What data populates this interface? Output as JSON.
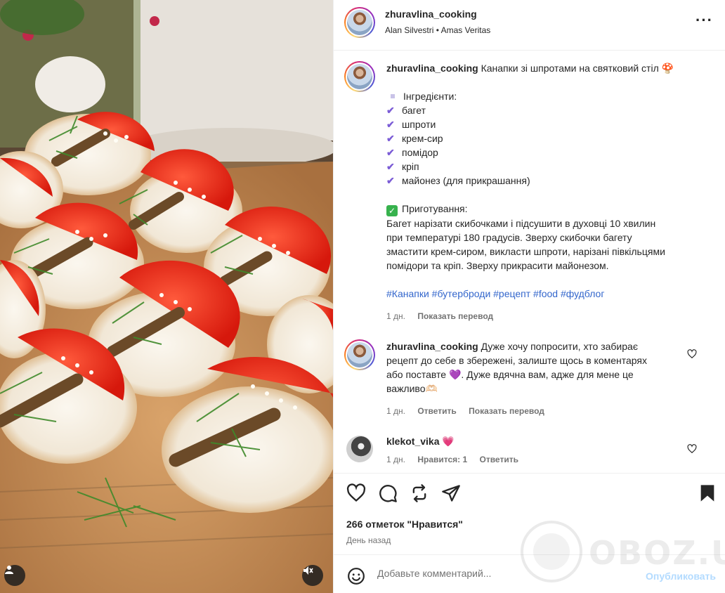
{
  "post": {
    "username": "zhuravlina_cooking",
    "audio": "Alan Silvestri • Amas Veritas",
    "more_icon": "more-horizontal-icon"
  },
  "caption": {
    "username": "zhuravlina_cooking",
    "title": "Канапки зі шпротами на святковий стіл",
    "title_emoji": "🍄",
    "ingredients_heading": "Інгредієнти:",
    "ingredients": [
      "багет",
      "шпроти",
      "крем-сир",
      "помідор",
      "кріп",
      "майонез (для прикрашання)"
    ],
    "prep_heading": "Приготування:",
    "prep_lines": [
      "Багет нарізати скибочками і підсушити в духовці 10 хвилин",
      "при температурі 180 градусів. Зверху скибочки багету",
      "змастити крем-сиром, викласти шпроти, нарізані півкільцями",
      "помідори та кріп. Зверху прикрасити майонезом."
    ],
    "hashtags": "#Канапки #бутерброди #рецепт #food #фудблог",
    "age": "1 дн.",
    "translate": "Показать перевод"
  },
  "comments": [
    {
      "username": "zhuravlina_cooking",
      "lines": [
        "Дуже хочу попросити, хто забирає",
        "рецепт до себе в збережені, залиште щось в коментарях",
        "або поставте",
        ". Дуже вдячна вам, адже для мене це",
        "важливо"
      ],
      "emoji_heart": "💜",
      "emoji_end": "🫶🏻",
      "age": "1 дн.",
      "reply": "Ответить",
      "translate": "Показать перевод"
    },
    {
      "username": "klekot_vika",
      "text": "💗",
      "age": "1 дн.",
      "likes": "Нравится: 1",
      "reply": "Ответить"
    }
  ],
  "actions": {
    "likes_text": "266 отметок \"Нравится\"",
    "time_text": "День назад"
  },
  "add_comment": {
    "placeholder": "Добавьте комментарий...",
    "publish": "Опубликовать"
  },
  "watermark": "OBOZ.UA",
  "colors": {
    "link": "#3366cc",
    "check_purple": "#7b5cd6",
    "check_green": "#37b24d",
    "publish_disabled": "#b3dbff"
  }
}
